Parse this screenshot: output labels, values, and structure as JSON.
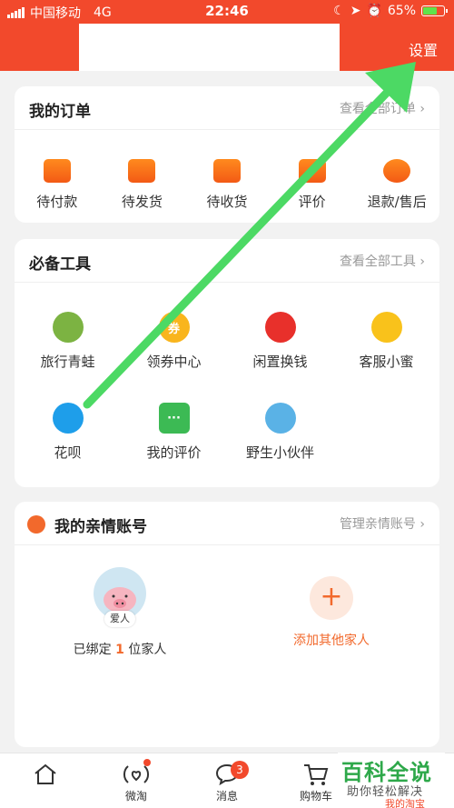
{
  "status_bar": {
    "carrier": "中国移动",
    "network": "4G",
    "time": "22:46",
    "battery_pct": "65%"
  },
  "header": {
    "settings_label": "设置"
  },
  "orders": {
    "title": "我的订单",
    "view_all": "查看全部订单 ›",
    "items": [
      {
        "label": "待付款",
        "icon": "wallet-icon"
      },
      {
        "label": "待发货",
        "icon": "package-icon"
      },
      {
        "label": "待收货",
        "icon": "truck-icon"
      },
      {
        "label": "评价",
        "icon": "comment-icon"
      },
      {
        "label": "退款/售后",
        "icon": "refund-icon"
      }
    ]
  },
  "tools": {
    "title": "必备工具",
    "view_all": "查看全部工具 ›",
    "row1": [
      {
        "label": "旅行青蛙",
        "icon": "frog-icon",
        "color": "#7cb342"
      },
      {
        "label": "领券中心",
        "icon": "coupon-icon",
        "color": "#f9b51d",
        "glyph": "券"
      },
      {
        "label": "闲置换钱",
        "icon": "moneybag-icon",
        "color": "#e8302b"
      },
      {
        "label": "客服小蜜",
        "icon": "chick-icon",
        "color": "#f9c21b"
      }
    ],
    "row2": [
      {
        "label": "花呗",
        "icon": "huabei-icon",
        "color": "#1e9eea"
      },
      {
        "label": "我的评价",
        "icon": "chat-icon",
        "color": "#3cba54"
      },
      {
        "label": "野生小伙伴",
        "icon": "polar-bear-icon",
        "color": "#5ab2e6"
      }
    ]
  },
  "family": {
    "title": "我的亲情账号",
    "manage": "管理亲情账号 ›",
    "avatar_tag": "爱人",
    "bound_prefix": "已绑定 ",
    "bound_count": "1",
    "bound_suffix": " 位家人",
    "add_symbol": "+",
    "add_label": "添加其他家人"
  },
  "tabbar": {
    "tabs": [
      {
        "label": "",
        "icon": "home-icon"
      },
      {
        "label": "微淘",
        "icon": "weitao-icon"
      },
      {
        "label": "消息",
        "icon": "message-icon",
        "badge": "3"
      },
      {
        "label": "购物车",
        "icon": "cart-icon"
      }
    ]
  },
  "watermark": {
    "title": "百科全说",
    "subtitle": "助你轻松解决",
    "partial": "我的淘宝"
  },
  "colors": {
    "brand": "#f2492c",
    "accent_orange": "#f2692c",
    "annotation_arrow": "#4cd964"
  }
}
